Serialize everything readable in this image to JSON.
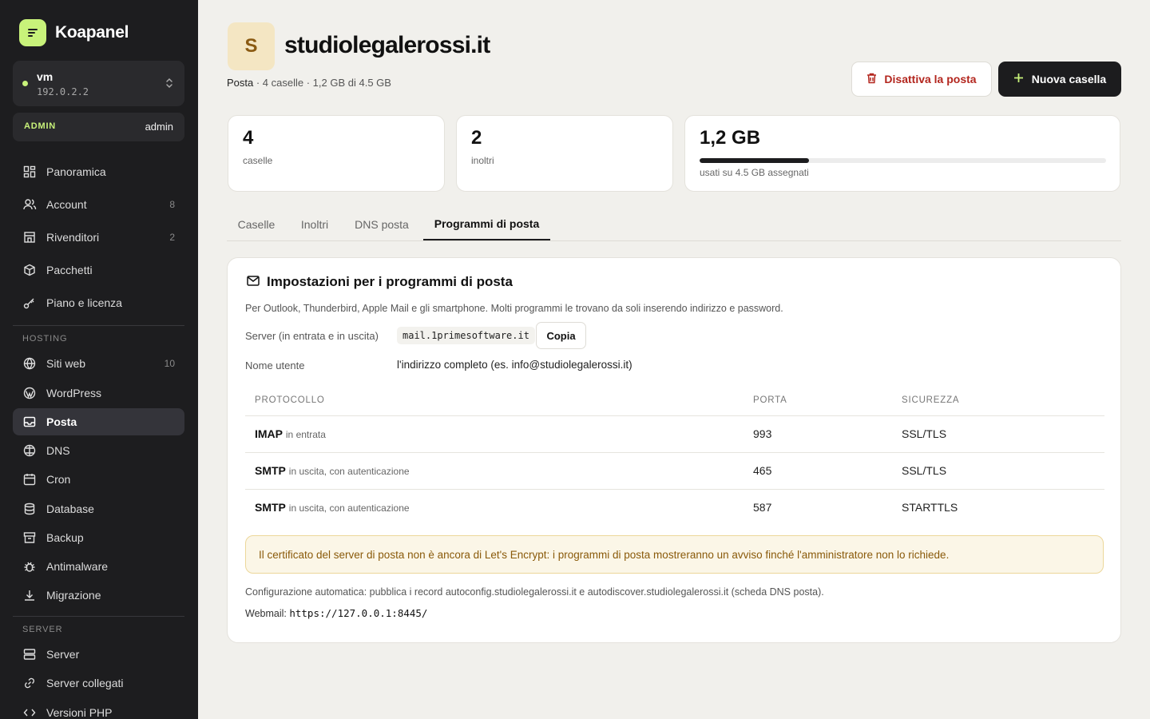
{
  "brand": {
    "name": "Koapanel",
    "accent": "#c8f27a"
  },
  "server_switch": {
    "name": "vm",
    "ip": "192.0.2.2",
    "icon": "chevron-updown-icon"
  },
  "role": {
    "tag": "ADMIN",
    "user": "admin"
  },
  "nav": {
    "main": [
      {
        "label": "Panoramica",
        "icon": "grid-icon",
        "count": ""
      },
      {
        "label": "Account",
        "icon": "users-icon",
        "count": "8"
      },
      {
        "label": "Rivenditori",
        "icon": "store-icon",
        "count": "2"
      },
      {
        "label": "Pacchetti",
        "icon": "package-icon",
        "count": ""
      },
      {
        "label": "Piano e licenza",
        "icon": "key-icon",
        "count": ""
      }
    ],
    "hosting_label": "HOSTING",
    "hosting": [
      {
        "label": "Siti web",
        "icon": "globe-icon",
        "count": "10"
      },
      {
        "label": "WordPress",
        "icon": "wordpress-icon",
        "count": ""
      },
      {
        "label": "Posta",
        "icon": "inbox-icon",
        "count": "",
        "active": true
      },
      {
        "label": "DNS",
        "icon": "dns-globe-icon",
        "count": ""
      },
      {
        "label": "Cron",
        "icon": "calendar-icon",
        "count": ""
      },
      {
        "label": "Database",
        "icon": "database-icon",
        "count": ""
      },
      {
        "label": "Backup",
        "icon": "archive-icon",
        "count": ""
      },
      {
        "label": "Antimalware",
        "icon": "bug-icon",
        "count": ""
      },
      {
        "label": "Migrazione",
        "icon": "download-icon",
        "count": ""
      }
    ],
    "server_label": "SERVER",
    "server": [
      {
        "label": "Server",
        "icon": "server-icon",
        "count": ""
      },
      {
        "label": "Server collegati",
        "icon": "link-icon",
        "count": ""
      },
      {
        "label": "Versioni PHP",
        "icon": "code-icon",
        "count": ""
      }
    ]
  },
  "header": {
    "avatar_letter": "S",
    "domain": "studiolegalerossi.it",
    "subtitle_section": "Posta",
    "subtitle_rest": " · 4 caselle · 1,2 GB di 4.5 GB",
    "disable_label": "Disattiva la posta",
    "new_label": "Nuova casella"
  },
  "stats": {
    "mailboxes": {
      "value": "4",
      "label": "caselle"
    },
    "forwards": {
      "value": "2",
      "label": "inoltri"
    },
    "storage": {
      "value": "1,2 GB",
      "label": "usati su 4.5 GB assegnati",
      "used_fraction": 0.27
    }
  },
  "tabs": [
    "Caselle",
    "Inoltri",
    "DNS posta",
    "Programmi di posta"
  ],
  "active_tab": "Programmi di posta",
  "panel": {
    "title": "Impostazioni per i programmi di posta",
    "description": "Per Outlook, Thunderbird, Apple Mail e gli smartphone. Molti programmi le trovano da soli inserendo indirizzo e password.",
    "server_label": "Server (in entrata e in uscita)",
    "server_value": "mail.1primesoftware.it",
    "copy_label": "Copia",
    "username_label": "Nome utente",
    "username_value": "l'indirizzo completo (es. info@studiolegalerossi.it)",
    "table": {
      "headers": [
        "PROTOCOLLO",
        "PORTA",
        "SICUREZZA"
      ],
      "rows": [
        {
          "protocol": "IMAP",
          "note": "in entrata",
          "port": "993",
          "security": "SSL/TLS"
        },
        {
          "protocol": "SMTP",
          "note": "in uscita, con autenticazione",
          "port": "465",
          "security": "SSL/TLS"
        },
        {
          "protocol": "SMTP",
          "note": "in uscita, con autenticazione",
          "port": "587",
          "security": "STARTTLS"
        }
      ]
    },
    "notice": "Il certificato del server di posta non è ancora di Let's Encrypt: i programmi di posta mostreranno un avviso finché l'amministratore non lo richiede.",
    "autoconfig": "Configurazione automatica: pubblica i record autoconfig.studiolegalerossi.it e autodiscover.studiolegalerossi.it (scheda DNS posta).",
    "webmail_label": "Webmail:",
    "webmail_url": "https://127.0.0.1:8445/"
  }
}
